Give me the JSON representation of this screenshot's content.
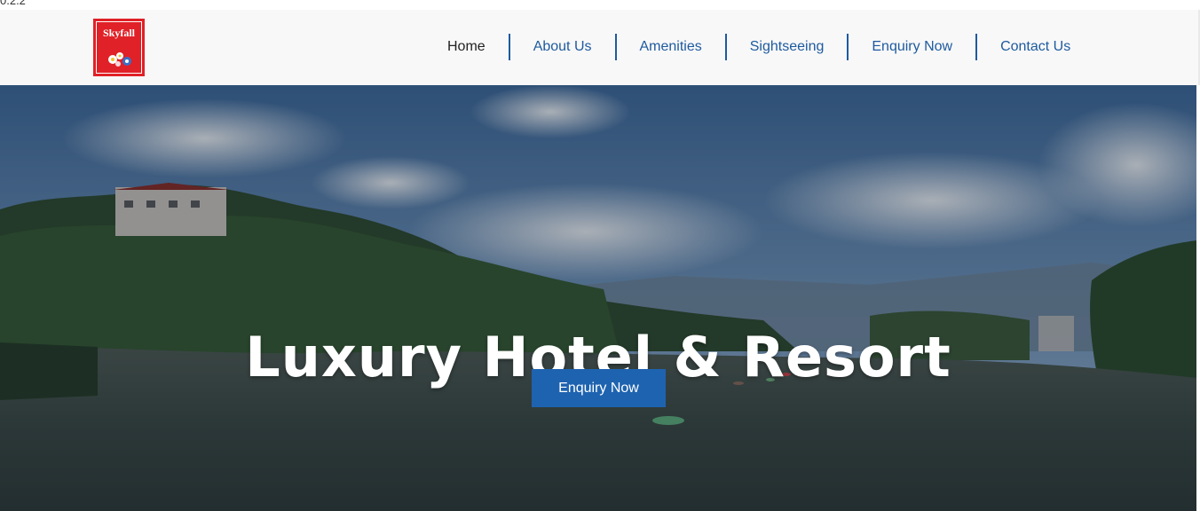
{
  "top_strip": {
    "text": "0.2.2"
  },
  "brand": {
    "name": "Skyfall"
  },
  "nav": {
    "items": [
      {
        "label": "Home"
      },
      {
        "label": "About Us"
      },
      {
        "label": "Amenities"
      },
      {
        "label": "Sightseeing"
      },
      {
        "label": "Enquiry Now"
      },
      {
        "label": "Contact Us"
      }
    ]
  },
  "hero": {
    "title": "Luxury Hotel & Resort",
    "button_label": "Enquiry Now"
  },
  "colors": {
    "nav_link": "#1e5a9e",
    "logo_red": "#e02127",
    "button_blue": "#1e63b0"
  }
}
